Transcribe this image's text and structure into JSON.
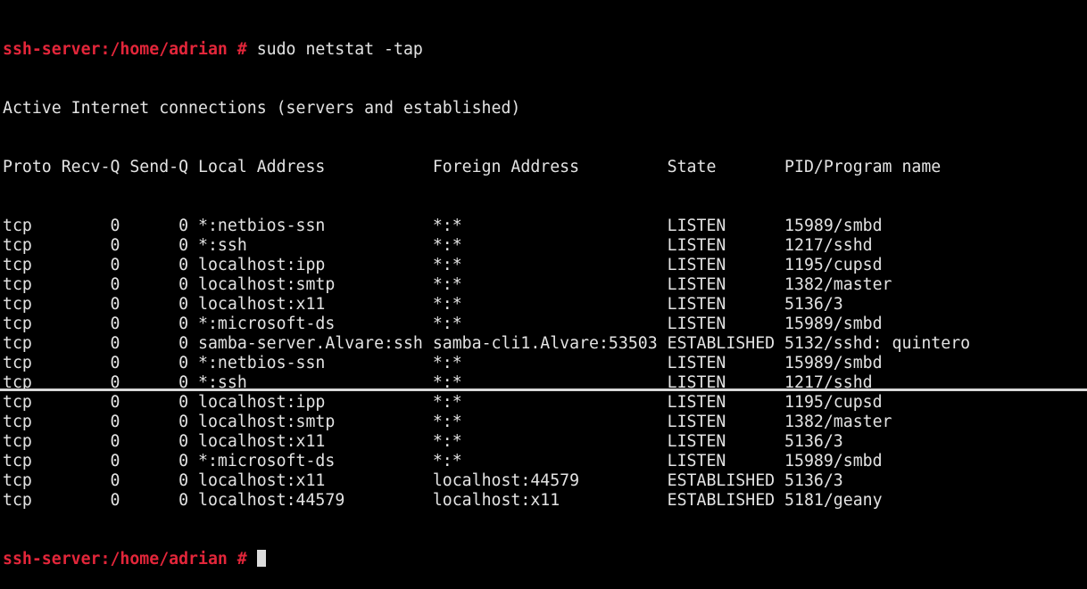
{
  "terminal": {
    "prompt": "ssh-server:/home/adrian #",
    "command": "sudo netstat -tap",
    "heading": "Active Internet connections (servers and established)",
    "columns": [
      "Proto",
      "Recv-Q",
      "Send-Q",
      "Local Address",
      "Foreign Address",
      "State",
      "PID/Program name"
    ],
    "rows": [
      [
        "tcp",
        "0",
        "0",
        "*:netbios-ssn",
        "*:*",
        "LISTEN",
        "15989/smbd"
      ],
      [
        "tcp",
        "0",
        "0",
        "*:ssh",
        "*:*",
        "LISTEN",
        "1217/sshd"
      ],
      [
        "tcp",
        "0",
        "0",
        "localhost:ipp",
        "*:*",
        "LISTEN",
        "1195/cupsd"
      ],
      [
        "tcp",
        "0",
        "0",
        "localhost:smtp",
        "*:*",
        "LISTEN",
        "1382/master"
      ],
      [
        "tcp",
        "0",
        "0",
        "localhost:x11",
        "*:*",
        "LISTEN",
        "5136/3"
      ],
      [
        "tcp",
        "0",
        "0",
        "*:microsoft-ds",
        "*:*",
        "LISTEN",
        "15989/smbd"
      ],
      [
        "tcp",
        "0",
        "0",
        "samba-server.Alvare:ssh",
        "samba-cli1.Alvare:53503",
        "ESTABLISHED",
        "5132/sshd: quintero"
      ],
      [
        "tcp",
        "0",
        "0",
        "*:netbios-ssn",
        "*:*",
        "LISTEN",
        "15989/smbd"
      ],
      [
        "tcp",
        "0",
        "0",
        "*:ssh",
        "*:*",
        "LISTEN",
        "1217/sshd"
      ],
      [
        "tcp",
        "0",
        "0",
        "localhost:ipp",
        "*:*",
        "LISTEN",
        "1195/cupsd"
      ],
      [
        "tcp",
        "0",
        "0",
        "localhost:smtp",
        "*:*",
        "LISTEN",
        "1382/master"
      ],
      [
        "tcp",
        "0",
        "0",
        "localhost:x11",
        "*:*",
        "LISTEN",
        "5136/3"
      ],
      [
        "tcp",
        "0",
        "0",
        "*:microsoft-ds",
        "*:*",
        "LISTEN",
        "15989/smbd"
      ],
      [
        "tcp",
        "0",
        "0",
        "localhost:x11",
        "localhost:44579",
        "ESTABLISHED",
        "5136/3"
      ],
      [
        "tcp",
        "0",
        "0",
        "localhost:44579",
        "localhost:x11",
        "ESTABLISHED",
        "5181/geany"
      ]
    ],
    "colors": {
      "background": "#000000",
      "foreground": "#e3e3e3",
      "prompt": "#e3263a",
      "cursor": "#dcdcdc"
    }
  }
}
